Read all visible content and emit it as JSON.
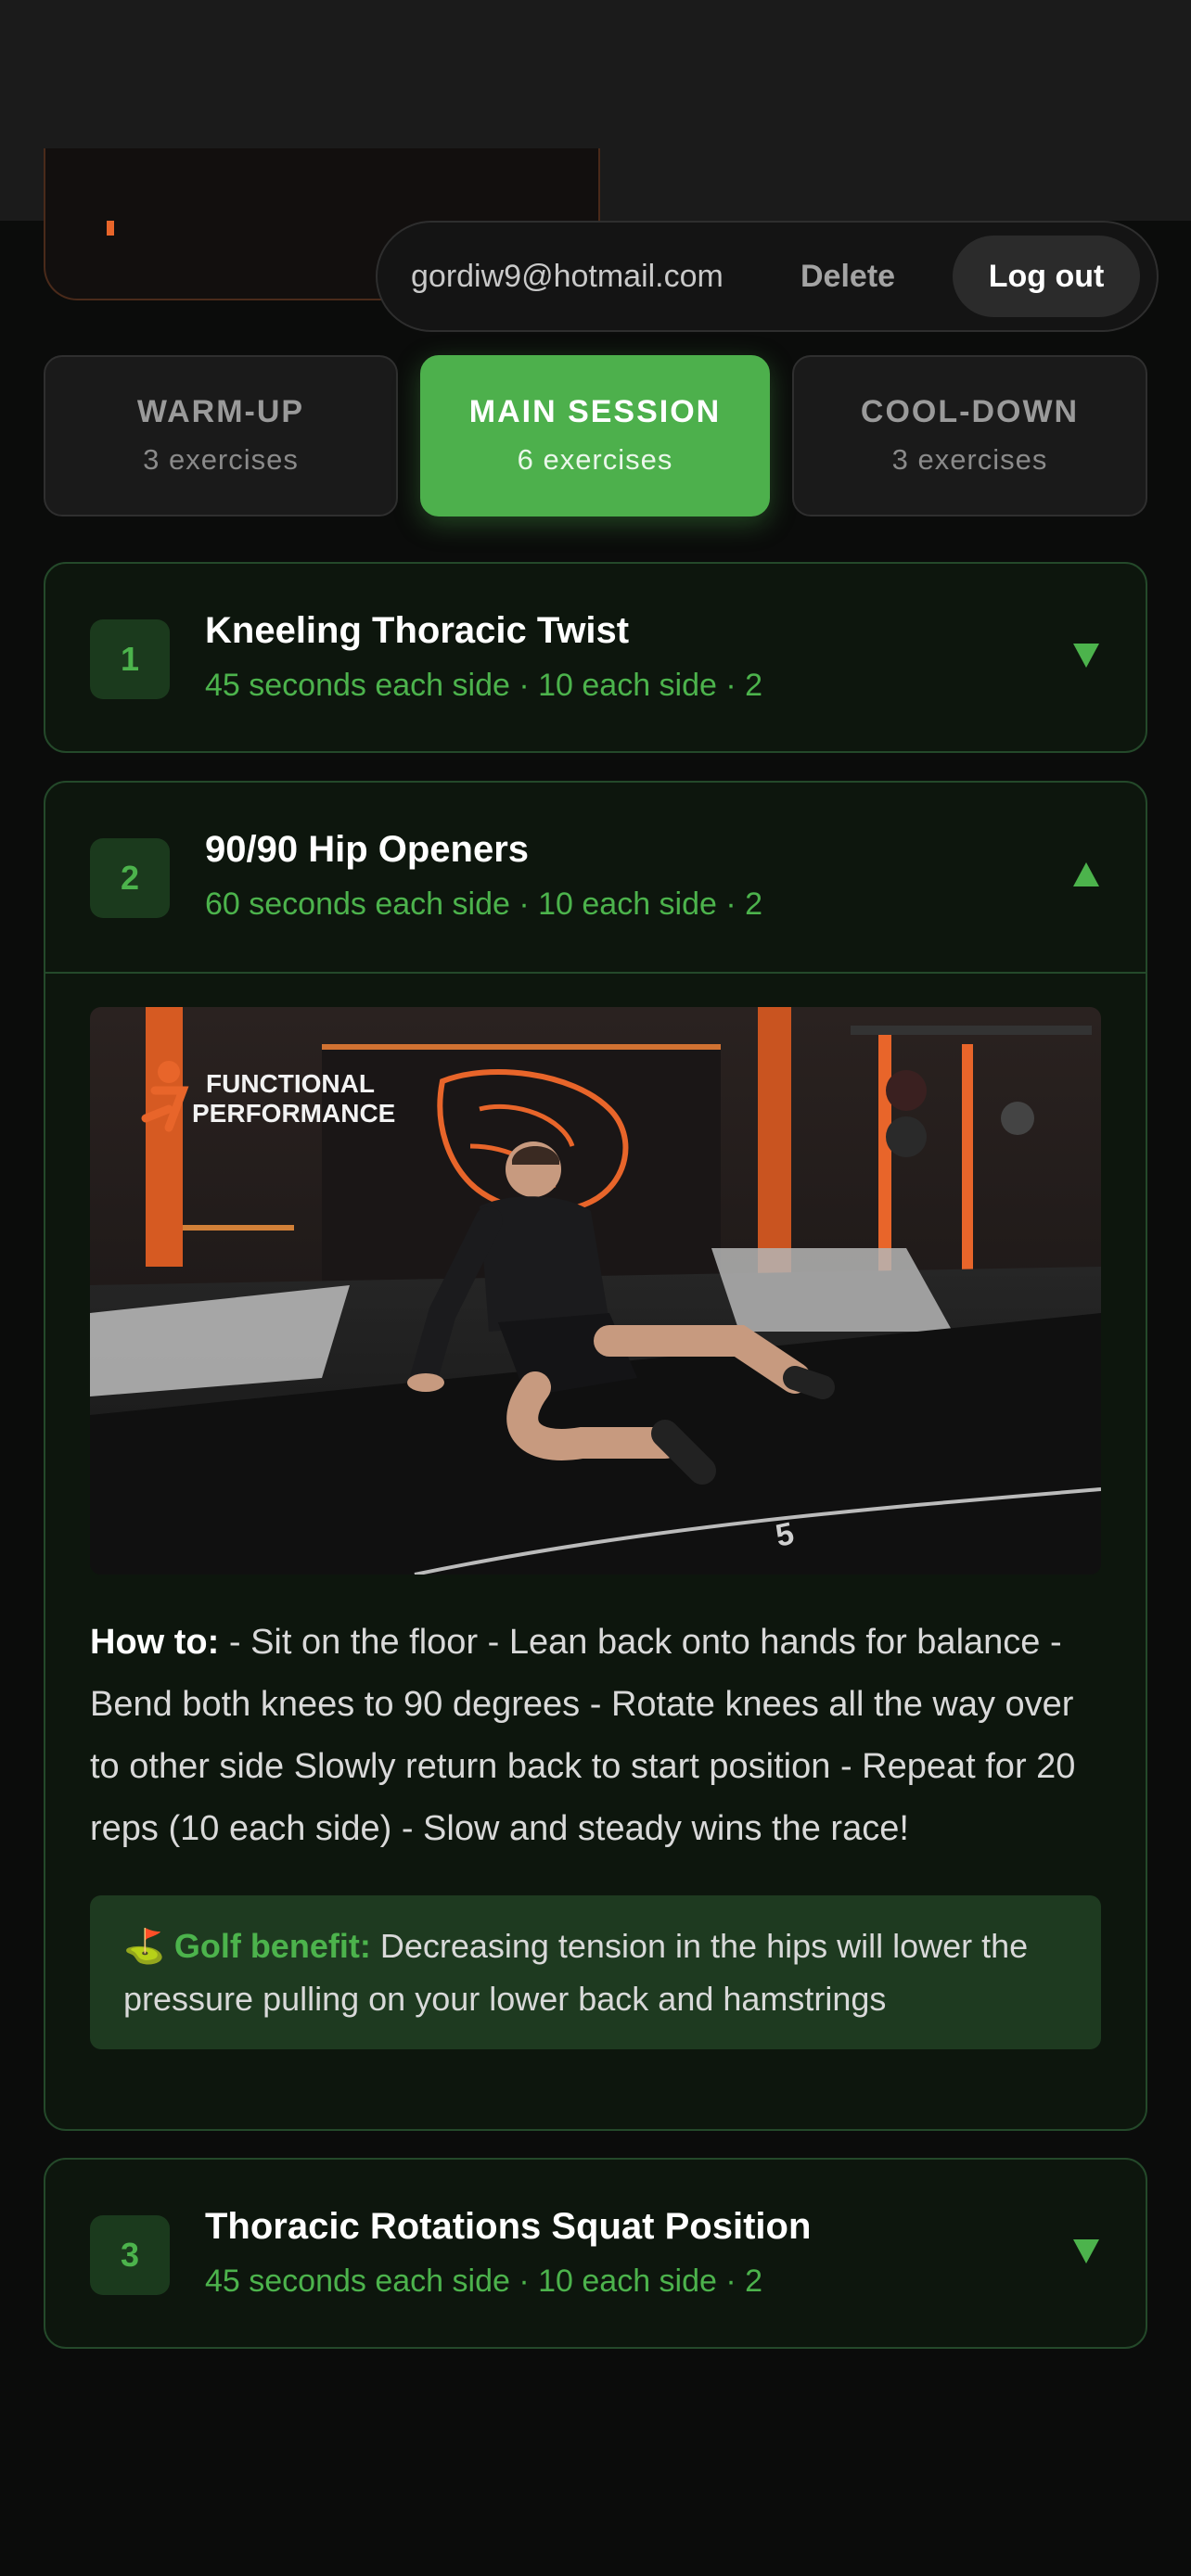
{
  "account": {
    "email": "gordiw9@hotmail.com",
    "delete_label": "Delete",
    "logout_label": "Log out"
  },
  "tabs": [
    {
      "title": "WARM-UP",
      "count": "3 exercises",
      "active": false
    },
    {
      "title": "MAIN SESSION",
      "count": "6 exercises",
      "active": true
    },
    {
      "title": "COOL-DOWN",
      "count": "3 exercises",
      "active": false
    }
  ],
  "exercises": [
    {
      "number": "1",
      "title": "Kneeling Thoracic Twist",
      "meta": "45 seconds each side · 10 each side · 2",
      "expanded": false
    },
    {
      "number": "2",
      "title": "90/90 Hip Openers",
      "meta": "60 seconds each side · 10 each side · 2",
      "expanded": true,
      "video": {
        "brand": "FUNCTIONAL PERFORMANCE",
        "floor_number": "5"
      },
      "how_to_label": "How to:",
      "how_to_text": " - Sit on the floor - Lean back onto hands for balance - Bend both knees to 90 degrees - Rotate knees all the way over to other side Slowly return back to start position - Repeat for 20 reps (10 each side) - Slow and steady wins the race!",
      "benefit_icon": "⛳",
      "benefit_label": "Golf benefit:",
      "benefit_text": " Decreasing tension in the hips will lower the pressure pulling on your lower back and hamstrings"
    },
    {
      "number": "3",
      "title": "Thoracic Rotations Squat Position",
      "meta": "45 seconds each side · 10 each side · 2",
      "expanded": false
    }
  ],
  "colors": {
    "accent": "#4db04c",
    "background": "#0b0c0b",
    "card_bg": "#0d160d",
    "card_border": "#24492a",
    "brand_orange": "#e8652a"
  },
  "icons": {
    "expand": "chevron-down-icon",
    "collapse": "chevron-up-icon",
    "benefit": "golf-flag-icon"
  }
}
